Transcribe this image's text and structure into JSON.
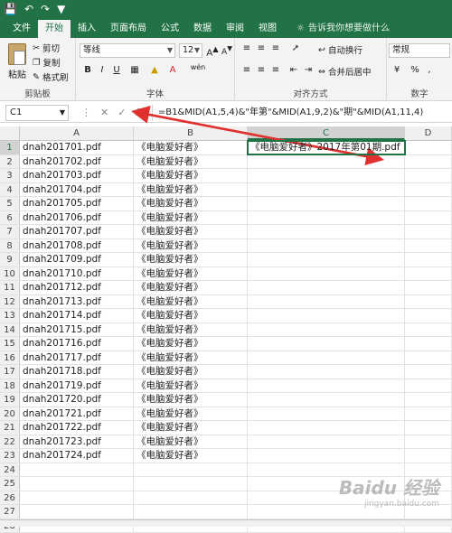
{
  "tabs": [
    "文件",
    "开始",
    "插入",
    "页面布局",
    "公式",
    "数据",
    "审阅",
    "视图"
  ],
  "tellme": "告诉我你想要做什么",
  "clipboard": {
    "paste": "粘贴",
    "cut": "剪切",
    "copy": "复制",
    "painter": "格式刷",
    "label": "剪贴板"
  },
  "font": {
    "name": "等线",
    "size": "12",
    "bold": "B",
    "italic": "I",
    "underline": "U",
    "label": "字体",
    "grow": "A",
    "shrink": "A",
    "wen": "wén"
  },
  "align": {
    "wrap": "自动换行",
    "merge": "合并后居中",
    "label": "对齐方式"
  },
  "number": {
    "format": "常规",
    "label": "数字",
    "percent": "%",
    "comma": ","
  },
  "namebox": "C1",
  "formula": "=B1&MID(A1,5,4)&\"年第\"&MID(A1,9,2)&\"期\"&MID(A1,11,4)",
  "columns": [
    "A",
    "B",
    "C",
    "D"
  ],
  "rows": [
    {
      "n": "1",
      "a": "dnah201701.pdf",
      "b": "《电脑爱好者》",
      "c": "《电脑爱好者》2017年第01期.pdf"
    },
    {
      "n": "2",
      "a": "dnah201702.pdf",
      "b": "《电脑爱好者》",
      "c": ""
    },
    {
      "n": "3",
      "a": "dnah201703.pdf",
      "b": "《电脑爱好者》",
      "c": ""
    },
    {
      "n": "4",
      "a": "dnah201704.pdf",
      "b": "《电脑爱好者》",
      "c": ""
    },
    {
      "n": "5",
      "a": "dnah201705.pdf",
      "b": "《电脑爱好者》",
      "c": ""
    },
    {
      "n": "6",
      "a": "dnah201706.pdf",
      "b": "《电脑爱好者》",
      "c": ""
    },
    {
      "n": "7",
      "a": "dnah201707.pdf",
      "b": "《电脑爱好者》",
      "c": ""
    },
    {
      "n": "8",
      "a": "dnah201708.pdf",
      "b": "《电脑爱好者》",
      "c": ""
    },
    {
      "n": "9",
      "a": "dnah201709.pdf",
      "b": "《电脑爱好者》",
      "c": ""
    },
    {
      "n": "10",
      "a": "dnah201710.pdf",
      "b": "《电脑爱好者》",
      "c": ""
    },
    {
      "n": "11",
      "a": "dnah201712.pdf",
      "b": "《电脑爱好者》",
      "c": ""
    },
    {
      "n": "12",
      "a": "dnah201713.pdf",
      "b": "《电脑爱好者》",
      "c": ""
    },
    {
      "n": "13",
      "a": "dnah201714.pdf",
      "b": "《电脑爱好者》",
      "c": ""
    },
    {
      "n": "14",
      "a": "dnah201715.pdf",
      "b": "《电脑爱好者》",
      "c": ""
    },
    {
      "n": "15",
      "a": "dnah201716.pdf",
      "b": "《电脑爱好者》",
      "c": ""
    },
    {
      "n": "16",
      "a": "dnah201717.pdf",
      "b": "《电脑爱好者》",
      "c": ""
    },
    {
      "n": "17",
      "a": "dnah201718.pdf",
      "b": "《电脑爱好者》",
      "c": ""
    },
    {
      "n": "18",
      "a": "dnah201719.pdf",
      "b": "《电脑爱好者》",
      "c": ""
    },
    {
      "n": "19",
      "a": "dnah201720.pdf",
      "b": "《电脑爱好者》",
      "c": ""
    },
    {
      "n": "20",
      "a": "dnah201721.pdf",
      "b": "《电脑爱好者》",
      "c": ""
    },
    {
      "n": "21",
      "a": "dnah201722.pdf",
      "b": "《电脑爱好者》",
      "c": ""
    },
    {
      "n": "22",
      "a": "dnah201723.pdf",
      "b": "《电脑爱好者》",
      "c": ""
    },
    {
      "n": "23",
      "a": "dnah201724.pdf",
      "b": "《电脑爱好者》",
      "c": ""
    },
    {
      "n": "24",
      "a": "",
      "b": "",
      "c": ""
    },
    {
      "n": "25",
      "a": "",
      "b": "",
      "c": ""
    },
    {
      "n": "26",
      "a": "",
      "b": "",
      "c": ""
    },
    {
      "n": "27",
      "a": "",
      "b": "",
      "c": ""
    },
    {
      "n": "28",
      "a": "",
      "b": "",
      "c": ""
    }
  ],
  "watermark": "Baidu 经验",
  "watermark_sub": "jingyan.baidu.com",
  "accent": "#217346",
  "arrow_color": "#e03030"
}
